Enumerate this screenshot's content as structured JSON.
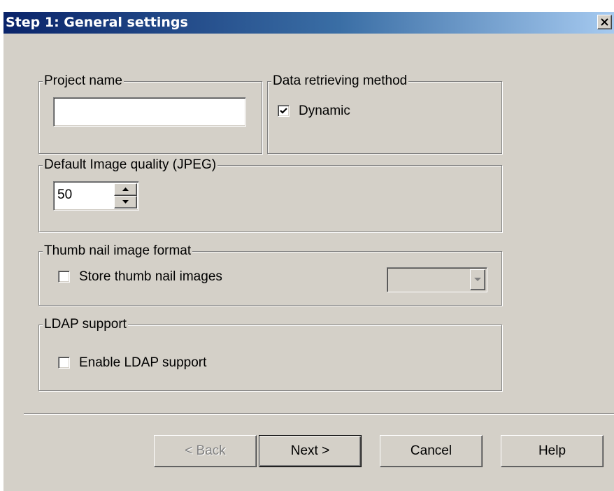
{
  "window": {
    "title": "Step 1: General settings"
  },
  "project_group": {
    "legend": "Project name",
    "input_value": ""
  },
  "retrieval_group": {
    "legend": "Data retrieving method",
    "dynamic_label": "Dynamic",
    "dynamic_checked": true
  },
  "quality_group": {
    "legend": "Default Image quality (JPEG)",
    "value": "50"
  },
  "thumb_group": {
    "legend": "Thumb nail image format",
    "checkbox_label": "Store thumb nail images",
    "checked": false,
    "format_value": ""
  },
  "ldap_group": {
    "legend": "LDAP support",
    "checkbox_label": "Enable LDAP support",
    "checked": false
  },
  "buttons": {
    "back": "< Back",
    "next": "Next >",
    "cancel": "Cancel",
    "help": "Help"
  },
  "colors": {
    "dialog_face": "#d4d0c8",
    "title_start": "#0a246a",
    "title_end": "#a6caf0"
  },
  "icons": {
    "close": "close-icon",
    "check": "checkmark-icon",
    "spin_up": "triangle-up-icon",
    "spin_down": "triangle-down-icon",
    "dropdown": "chevron-down-icon"
  }
}
